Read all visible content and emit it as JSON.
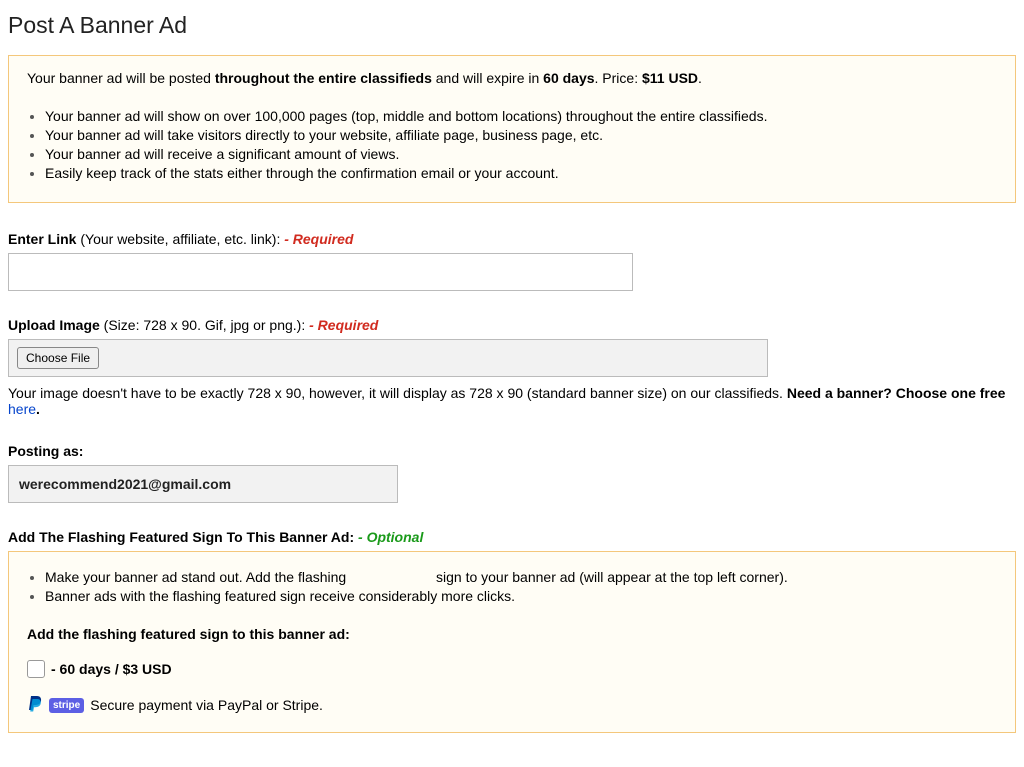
{
  "page_title": "Post A Banner Ad",
  "info": {
    "intro_a": "Your banner ad will be posted ",
    "intro_b_bold": "throughout the entire classifieds",
    "intro_c": " and will expire in ",
    "intro_d_bold": "60 days",
    "intro_e": ". Price: ",
    "intro_f_bold": "$11 USD",
    "intro_g": ".",
    "bullets": [
      "Your banner ad will show on over 100,000 pages (top, middle and bottom locations) throughout the entire classifieds.",
      "Your banner ad will take visitors directly to your website, affiliate page, business page, etc.",
      "Your banner ad will receive a significant amount of views.",
      "Easily keep track of the stats either through the confirmation email or your account."
    ]
  },
  "link_field": {
    "label_bold": "Enter Link",
    "label_rest": " (Your website, affiliate, etc. link):  ",
    "req": "- Required",
    "value": ""
  },
  "upload_field": {
    "label_bold": "Upload Image",
    "label_rest": " (Size: 728 x 90. Gif, jpg or png.):  ",
    "req": "- Required",
    "button": "Choose File",
    "hint_a": "Your image doesn't have to be exactly 728 x 90, however, it will display as 728 x 90 (standard banner size) on our classifieds. ",
    "hint_b_bold": "Need a banner? Choose one free ",
    "hint_link": "here",
    "hint_c": "."
  },
  "posting_as": {
    "label": "Posting as:",
    "value": "werecommend2021@gmail.com"
  },
  "featured": {
    "heading_bold": "Add The Flashing Featured Sign To This Banner Ad:  ",
    "opt": "- Optional",
    "bullet1_a": "Make your banner ad stand out. Add the flashing ",
    "bullet1_b": " sign to your banner ad (will appear at the top left corner).",
    "bullet2": "Banner ads with the flashing featured sign receive considerably more clicks.",
    "sub_heading": "Add the flashing featured sign to this banner ad:",
    "price_label": "- 60 days / $3 USD",
    "payment_text": "Secure payment via PayPal or Stripe.",
    "stripe_label": "stripe"
  }
}
